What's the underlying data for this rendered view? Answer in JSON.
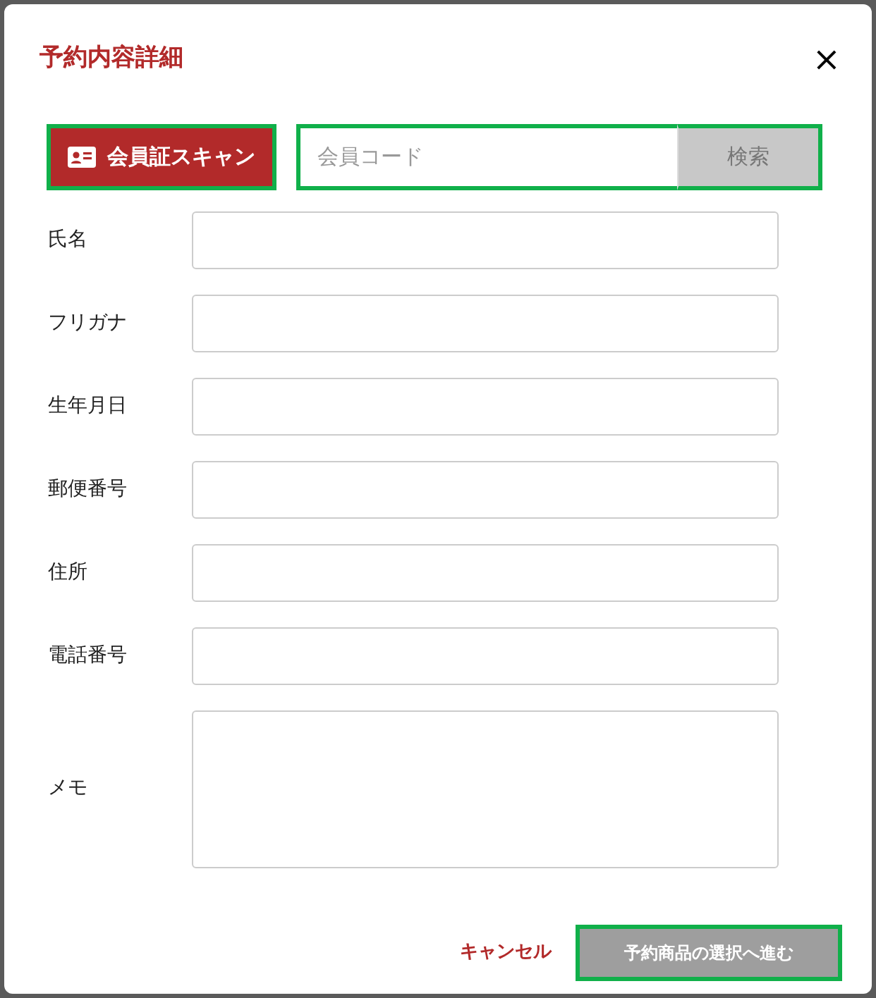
{
  "dialog": {
    "title": "予約内容詳細",
    "close": "×"
  },
  "scan_button": {
    "label": "会員証スキャン"
  },
  "member_search": {
    "placeholder": "会員コード",
    "button": "検索",
    "disabled": true
  },
  "fields": [
    {
      "label": "氏名",
      "kind": "text"
    },
    {
      "label": "フリガナ",
      "kind": "text"
    },
    {
      "label": "生年月日",
      "kind": "text"
    },
    {
      "label": "郵便番号",
      "kind": "text"
    },
    {
      "label": "住所",
      "kind": "text"
    },
    {
      "label": "電話番号",
      "kind": "text"
    },
    {
      "label": "メモ",
      "kind": "textarea"
    }
  ],
  "footer": {
    "cancel": "キャンセル",
    "proceed": "予約商品の選択へ進む",
    "proceed_disabled": true
  }
}
